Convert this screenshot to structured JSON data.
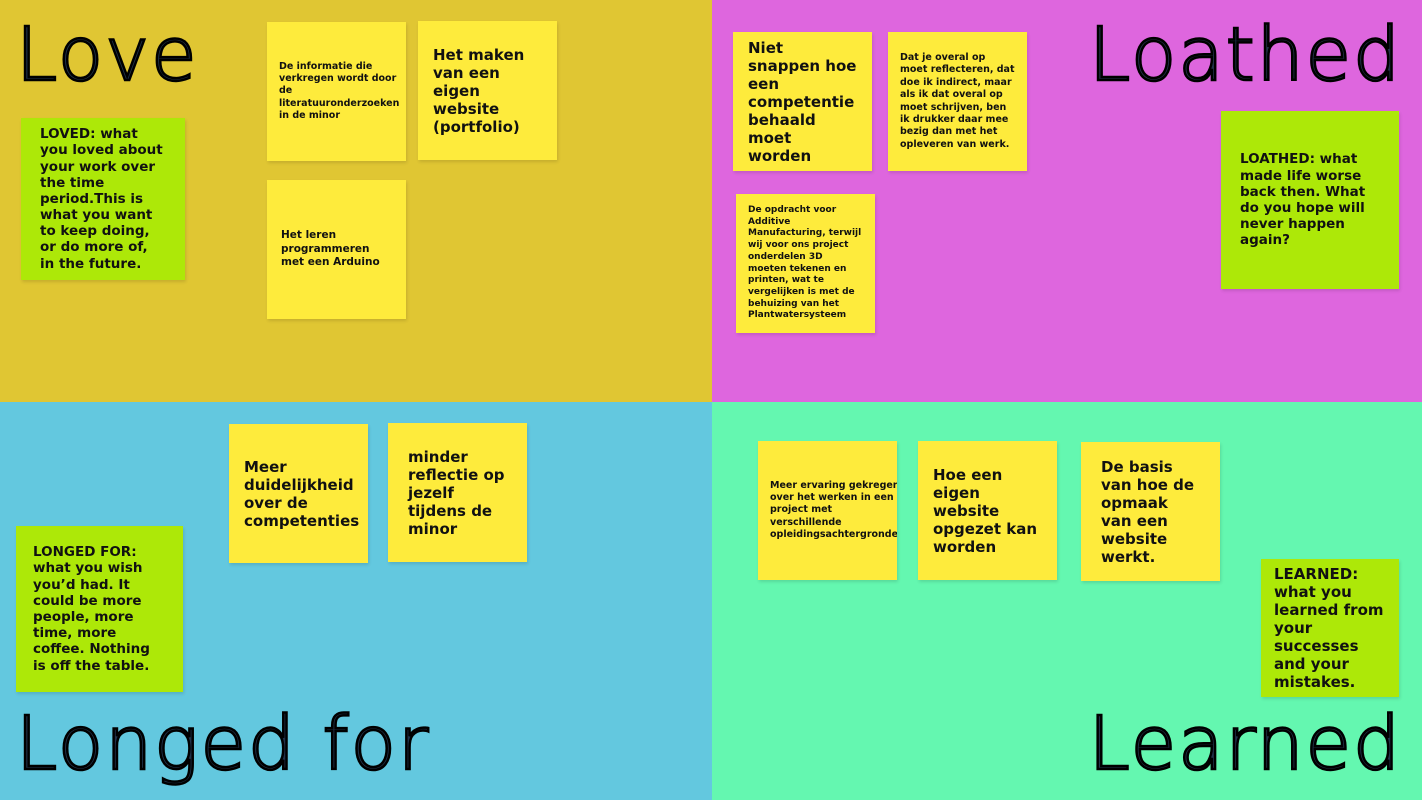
{
  "love": {
    "title": "Love",
    "prompt": "LOVED: what you loved about your work over the time period.This is what you want to keep doing, or do more of, in the future.",
    "notes": [
      "De informatie die verkregen wordt door de literatuuronderzoeken in de minor",
      "Het maken van een eigen website (portfolio)",
      "Het leren programmeren met een Arduino"
    ]
  },
  "loathed": {
    "title": "Loathed",
    "prompt": "LOATHED: what made life worse back then. What do you hope will never happen again?",
    "notes": [
      "Niet snappen hoe een competentie behaald moet worden",
      "Dat je overal op moet reflecteren, dat doe ik indirect, maar als ik dat overal op moet schrijven, ben ik drukker daar mee bezig dan met het opleveren van werk.",
      "De opdracht voor Additive Manufacturing, terwijl wij voor ons project onderdelen 3D moeten tekenen en printen, wat te vergelijken is met de behuizing van het Plantwatersysteem"
    ]
  },
  "longed": {
    "title": "Longed for",
    "prompt": "LONGED FOR: what you wish you’d had. It could be more people, more time, more coffee. Nothing is off the table.",
    "notes": [
      "Meer duidelijkheid over de competenties",
      "minder reflectie op jezelf tijdens de minor"
    ]
  },
  "learned": {
    "title": "Learned",
    "prompt": "LEARNED: what you learned from your successes and your mistakes.",
    "notes": [
      "Meer ervaring gekregen over het werken in een project met verschillende opleidingsachtergronden",
      "Hoe een eigen website opgezet kan worden",
      "De basis van hoe de opmaak van een website werkt."
    ]
  },
  "colors": {
    "love_bg": "#e0c633",
    "loathed_bg": "#de66de",
    "longed_bg": "#63c8df",
    "learned_bg": "#64f7b0",
    "sticky_yellow": "#feeb3c",
    "sticky_green": "#ade808"
  }
}
